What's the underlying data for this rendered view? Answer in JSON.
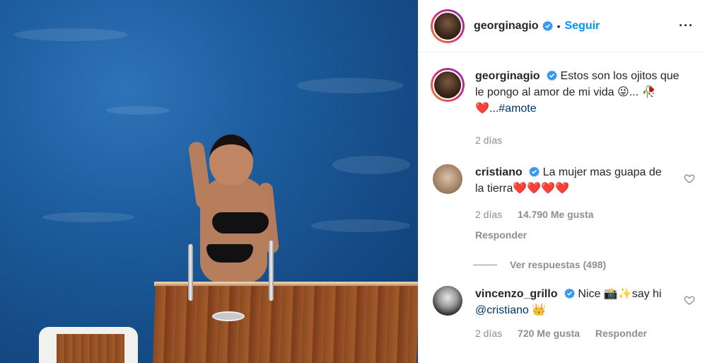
{
  "header": {
    "username": "georginagio",
    "separator": "•",
    "follow_label": "Seguir",
    "more_label": "···"
  },
  "caption": {
    "username": "georginagio",
    "text": "Estos son los ojitos que le pongo al amor de mi vida",
    "emoji_face": "😜",
    "ellipsis1": "...",
    "emoji_rose": "🥀",
    "emoji_heart": "❤️",
    "ellipsis2": "...",
    "hashtag": "#amote",
    "time": "2 días"
  },
  "comments": [
    {
      "username": "cristiano",
      "text": "La mujer mas guapa de la tierra",
      "hearts": "❤️❤️❤️❤️",
      "time": "2 días",
      "likes": "14.790 Me gusta",
      "reply": "Responder"
    },
    {
      "username": "vincenzo_grillo",
      "text_before": "Nice",
      "emoji1": "📸",
      "emoji2": "✨",
      "text_after": "say hi",
      "mention": "@cristiano",
      "emoji3": "👑",
      "time": "2 días",
      "likes": "720 Me gusta",
      "reply": "Responder"
    }
  ],
  "view_replies": "Ver respuestas (498)",
  "colors": {
    "accent": "#0095f6",
    "verified": "#3897f0",
    "muted": "#8e8e8e",
    "text": "#262626",
    "heart": "#ed1b2e"
  }
}
